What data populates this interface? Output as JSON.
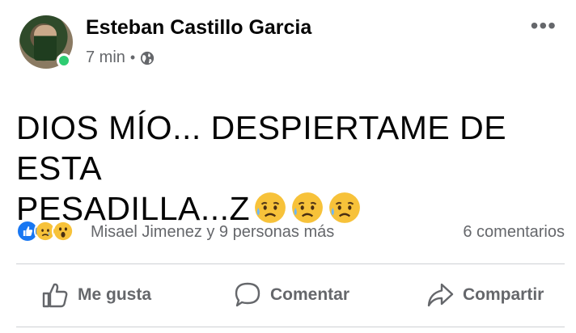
{
  "post": {
    "author": "Esteban Castillo Garcia",
    "time": "7 min",
    "separator": "•",
    "privacy_icon": "globe-icon",
    "more_label": "•••",
    "text_line1": "DIOS MÍO... DESPIERTAME DE ESTA",
    "text_line2": "PESADILLA...Z",
    "text_emojis": [
      "sad-face-with-tear-icon",
      "sad-face-with-tear-icon",
      "sad-face-with-tear-icon"
    ]
  },
  "reactions": {
    "icons": [
      "like-icon",
      "sad-icon",
      "wow-icon"
    ],
    "summary": "Misael Jimenez y 9 personas más",
    "comments": "6 comentarios"
  },
  "actions": {
    "like": "Me gusta",
    "comment": "Comentar",
    "share": "Compartir"
  },
  "colors": {
    "like_blue": "#1877f2",
    "secondary_text": "#65676b",
    "online_green": "#2ecc71",
    "divider": "#ced0d4"
  }
}
